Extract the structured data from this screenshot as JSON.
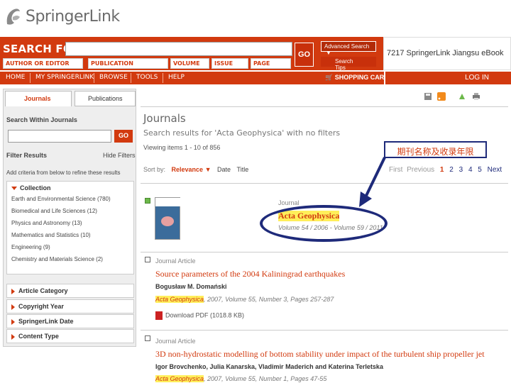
{
  "logo": {
    "name": "SpringerLink"
  },
  "search": {
    "label": "SEARCH FOR",
    "go": "GO",
    "fields": [
      "AUTHOR OR EDITOR",
      "PUBLICATION",
      "VOLUME",
      "ISSUE",
      "PAGE"
    ],
    "advanced": "Advanced Search",
    "tips": "Search Tips"
  },
  "institution": "7217 SpringerLink Jiangsu eBook",
  "nav": {
    "items": [
      "HOME",
      "MY SPRINGERLINK",
      "BROWSE",
      "TOOLS",
      "HELP"
    ],
    "cart": "SHOPPING CART",
    "login": "LOG IN"
  },
  "sidebar": {
    "tabs": [
      "Journals",
      "Publications"
    ],
    "search_within": "Search Within Journals",
    "go": "GO",
    "filter_results": "Filter Results",
    "hide_filters": "Hide Filters",
    "add_criteria": "Add criteria from below to refine these results",
    "collection": "Collection",
    "collection_items": [
      "Earth and Environmental Science (780)",
      "Biomedical and Life Sciences (12)",
      "Physics and Astronomy (13)",
      "Mathematics and Statistics (10)",
      "Engineering (9)",
      "Chemistry and Materials Science (2)"
    ],
    "facets": [
      "Article Category",
      "Copyright Year",
      "SpringerLink Date",
      "Content Type"
    ]
  },
  "main": {
    "title": "Journals",
    "subtitle": "Search results for 'Acta Geophysica' with no filters",
    "viewing": "Viewing items 1 - 10 of 856",
    "annotation": "期刊名称及收录年限",
    "sort_by": "Sort by:",
    "sort_options": [
      "Relevance",
      "Date",
      "Title"
    ],
    "pager": {
      "first": "First",
      "previous": "Previous",
      "pages": [
        "1",
        "2",
        "3",
        "4",
        "5"
      ],
      "next": "Next"
    },
    "results": [
      {
        "type": "Journal",
        "title": "Acta Geophysica",
        "volumes": "Volume 54 / 2006 - Volume 59 / 2011"
      },
      {
        "type": "Journal Article",
        "title": "Source parameters of the 2004 Kaliningrad earthquakes",
        "authors": "Bogusław M. Domański",
        "journal": "Acta Geophysica",
        "citation": ", 2007, Volume 55, Number 3, Pages 257-287",
        "pdf": "Download PDF (1018.8 KB)"
      },
      {
        "type": "Journal Article",
        "title": "3D non-hydrostatic modelling of bottom stability under impact of the turbulent ship propeller jet",
        "authors": "Igor Brovchenko, Julia Kanarska, Vladimir Maderich and Katerina Terletska",
        "journal": "Acta Geophysica",
        "citation": ", 2007, Volume 55, Number 1, Pages 47-55"
      }
    ]
  },
  "colors": {
    "brand": "#d23a0f",
    "highlight": "#ffef5a",
    "annotation": "#1e2a7a"
  }
}
